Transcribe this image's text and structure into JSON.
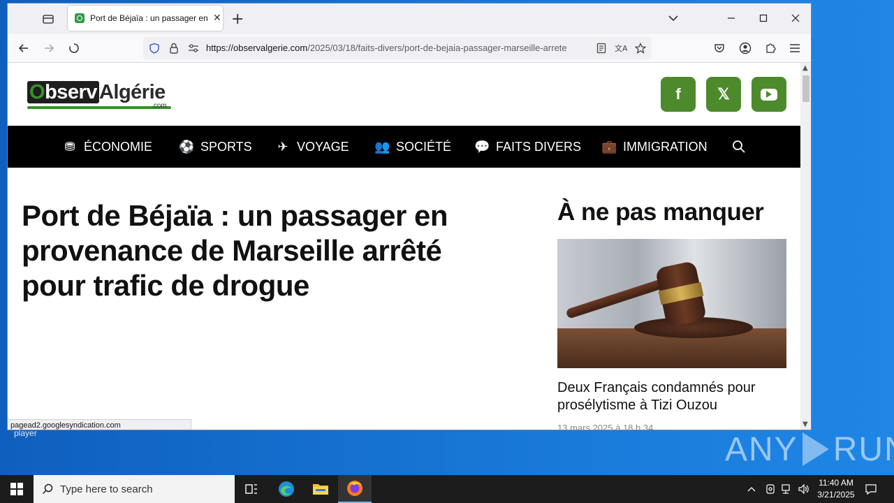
{
  "browser": {
    "tab_title": "Port de Béjaïa : un passager en provenance de Marseille",
    "tab_close": "✕",
    "new_tab": "+",
    "url_host": "https://observalgerie.com",
    "url_path": "/2025/03/18/faits-divers/port-de-bejaia-passager-marseille-arrete",
    "status_text": "pagead2.googlesyndication.com"
  },
  "site": {
    "logo_o": "O",
    "logo_observ": "bserv",
    "logo_algerie": "Algérie",
    "logo_com": ".com",
    "social": {
      "facebook": "f",
      "x": "𝕏",
      "youtube": "▶"
    },
    "nav": [
      {
        "label": "ÉCONOMIE",
        "icon": "coins-icon",
        "glyph": "⛃"
      },
      {
        "label": "SPORTS",
        "icon": "soccer-ball-icon",
        "glyph": "⚽"
      },
      {
        "label": "VOYAGE",
        "icon": "plane-icon",
        "glyph": "✈"
      },
      {
        "label": "SOCIÉTÉ",
        "icon": "users-icon",
        "glyph": "👥"
      },
      {
        "label": "FAITS DIVERS",
        "icon": "comments-icon",
        "glyph": "💬"
      },
      {
        "label": "IMMIGRATION",
        "icon": "suitcase-icon",
        "glyph": "💼"
      }
    ],
    "headline": "Port de Béjaïa : un passager en provenance de Marseille arrêté pour trafic de drogue",
    "sidebar": {
      "title": "À ne pas manquer",
      "article_title": "Deux Français condamnés pour prosélytisme à Tizi Ouzou",
      "article_date": "13 mars 2025 à 18 h 34"
    }
  },
  "desktop": {
    "label": "player",
    "watermark_left": "ANY",
    "watermark_right": "RUN"
  },
  "taskbar": {
    "search_placeholder": "Type here to search",
    "time": "11:40 AM",
    "date": "3/21/2025"
  },
  "colors": {
    "brand_green": "#4d8a2c",
    "nav_bg": "#000000",
    "taskbar_bg": "#1c1c1c"
  }
}
